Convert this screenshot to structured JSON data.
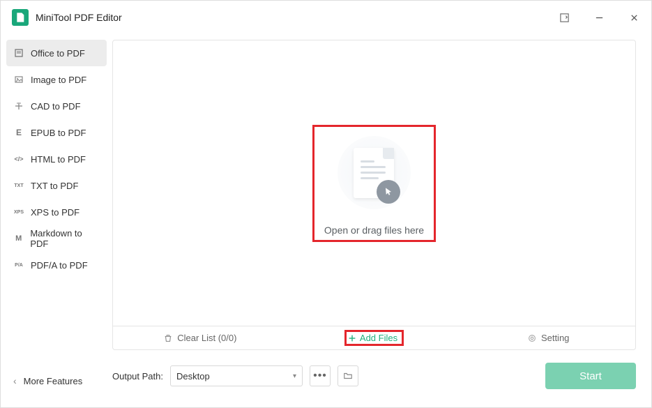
{
  "app": {
    "title": "MiniTool PDF Editor"
  },
  "sidebar": {
    "items": [
      {
        "label": "Office to PDF",
        "icon_text": ""
      },
      {
        "label": "Image to PDF",
        "icon_text": ""
      },
      {
        "label": "CAD to PDF",
        "icon_text": ""
      },
      {
        "label": "EPUB to PDF",
        "icon_text": "E"
      },
      {
        "label": "HTML to PDF",
        "icon_text": "</>"
      },
      {
        "label": "TXT to PDF",
        "icon_text": "TXT"
      },
      {
        "label": "XPS to PDF",
        "icon_text": "XPS"
      },
      {
        "label": "Markdown to PDF",
        "icon_text": "M"
      },
      {
        "label": "PDF/A to PDF",
        "icon_text": "P/A"
      }
    ],
    "more_label": "More Features"
  },
  "drop": {
    "text": "Open or drag files here"
  },
  "toolbar": {
    "clear_label": "Clear List (0/0)",
    "add_label": "Add Files",
    "setting_label": "Setting"
  },
  "footer": {
    "output_label": "Output Path:",
    "path_value": "Desktop",
    "start_label": "Start"
  }
}
